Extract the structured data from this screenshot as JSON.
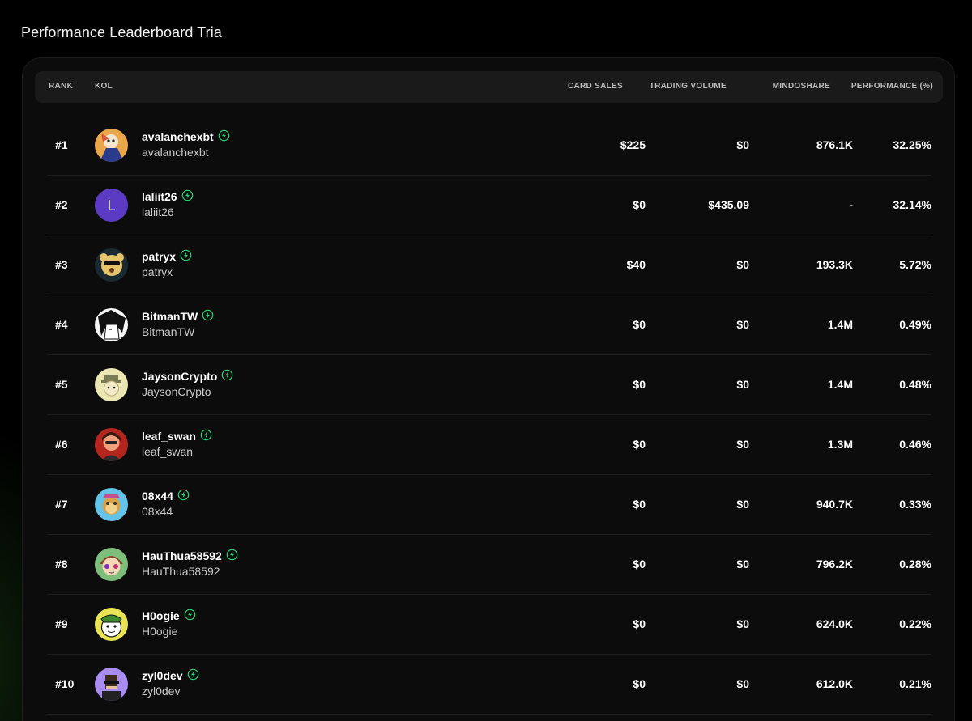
{
  "page": {
    "title": "Performance Leaderboard Tria"
  },
  "table": {
    "headers": {
      "rank": "RANK",
      "kol": "KOL",
      "card_sales": "CARD SALES",
      "trading_volume": "TRADING VOLUME",
      "mindoshare": "MINDOSHARE",
      "performance": "PERFORMANCE (%)"
    },
    "rows": [
      {
        "rank": "#1",
        "name": "avalanchexbt",
        "handle": "avalanchexbt",
        "card_sales": "$225",
        "trading_volume": "$0",
        "mindoshare": "876.1K",
        "performance": "32.25%",
        "avatar_icon": "avatar-illustrated"
      },
      {
        "rank": "#2",
        "name": "laliit26",
        "handle": "laliit26",
        "card_sales": "$0",
        "trading_volume": "$435.09",
        "mindoshare": "-",
        "performance": "32.14%",
        "avatar_icon": "avatar-letter",
        "avatar_letter": "L"
      },
      {
        "rank": "#3",
        "name": "patryx",
        "handle": "patryx",
        "card_sales": "$40",
        "trading_volume": "$0",
        "mindoshare": "193.3K",
        "performance": "5.72%",
        "avatar_icon": "avatar-bear"
      },
      {
        "rank": "#4",
        "name": "BitmanTW",
        "handle": "BitmanTW",
        "card_sales": "$0",
        "trading_volume": "$0",
        "mindoshare": "1.4M",
        "performance": "0.49%",
        "avatar_icon": "avatar-manga"
      },
      {
        "rank": "#5",
        "name": "JaysonCrypto",
        "handle": "JaysonCrypto",
        "card_sales": "$0",
        "trading_volume": "$0",
        "mindoshare": "1.4M",
        "performance": "0.48%",
        "avatar_icon": "avatar-hat"
      },
      {
        "rank": "#6",
        "name": "leaf_swan",
        "handle": "leaf_swan",
        "card_sales": "$0",
        "trading_volume": "$0",
        "mindoshare": "1.3M",
        "performance": "0.46%",
        "avatar_icon": "avatar-portrait"
      },
      {
        "rank": "#7",
        "name": "08x44",
        "handle": "08x44",
        "card_sales": "$0",
        "trading_volume": "$0",
        "mindoshare": "940.7K",
        "performance": "0.33%",
        "avatar_icon": "avatar-ape"
      },
      {
        "rank": "#8",
        "name": "HauThua58592",
        "handle": "HauThua58592",
        "card_sales": "$0",
        "trading_volume": "$0",
        "mindoshare": "796.2K",
        "performance": "0.28%",
        "avatar_icon": "avatar-anime"
      },
      {
        "rank": "#9",
        "name": "H0ogie",
        "handle": "H0ogie",
        "card_sales": "$0",
        "trading_volume": "$0",
        "mindoshare": "624.0K",
        "performance": "0.22%",
        "avatar_icon": "avatar-cartoon"
      },
      {
        "rank": "#10",
        "name": "zyl0dev",
        "handle": "zyl0dev",
        "card_sales": "$0",
        "trading_volume": "$0",
        "mindoshare": "612.0K",
        "performance": "0.21%",
        "avatar_icon": "avatar-pixel"
      }
    ]
  },
  "colors": {
    "verified": "#2bd576",
    "background": "#000000",
    "panel": "#0c0c0c",
    "header": "#1a1a1a"
  }
}
